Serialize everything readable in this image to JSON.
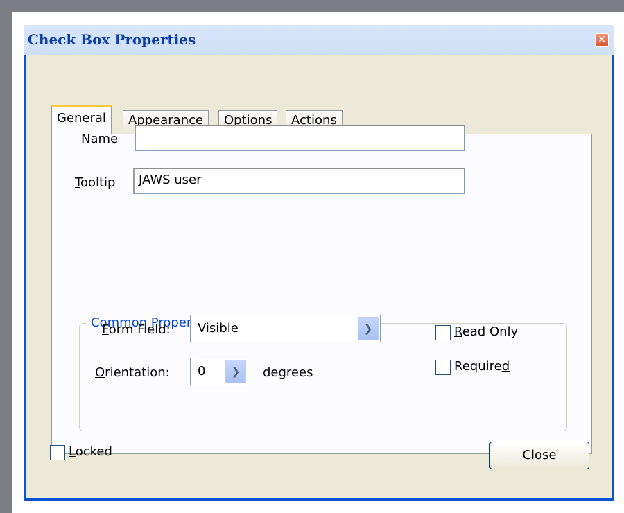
{
  "window": {
    "title": "Check Box Properties",
    "close_glyph": "✕"
  },
  "tabs": [
    {
      "label": "General",
      "active": true
    },
    {
      "label": "Appearance",
      "active": false
    },
    {
      "label": "Options",
      "active": false
    },
    {
      "label": "Actions",
      "active": false
    }
  ],
  "general": {
    "name": {
      "label_ul": "N",
      "label_rest": "ame",
      "value": ""
    },
    "tooltip": {
      "label_ul": "T",
      "label_rest": "ooltip",
      "value": "JAWS user"
    }
  },
  "common_properties": {
    "title": "Common Properties",
    "form_field": {
      "label_ul": "F",
      "label_rest": "orm Field:",
      "value": "Visible"
    },
    "orientation": {
      "label_ul": "O",
      "label_rest": "rientation:",
      "value": "0",
      "unit": "degrees"
    },
    "read_only": {
      "label_ul": "R",
      "label_rest": "ead Only",
      "checked": false
    },
    "required": {
      "label_pre": "Require",
      "label_ul": "d",
      "checked": false
    }
  },
  "footer": {
    "locked": {
      "label_ul": "L",
      "label_rest": "ocked",
      "checked": false
    },
    "close_button": {
      "label_ul": "C",
      "label_rest": "lose"
    }
  },
  "icons": {
    "dropdown": "chevron-down-icon",
    "close": "close-icon"
  },
  "colors": {
    "title_bar_text": "#0c3ea8",
    "window_frame": "#0a52d6",
    "active_tab_accent": "#ffc83c",
    "group_title": "#0046d5"
  }
}
